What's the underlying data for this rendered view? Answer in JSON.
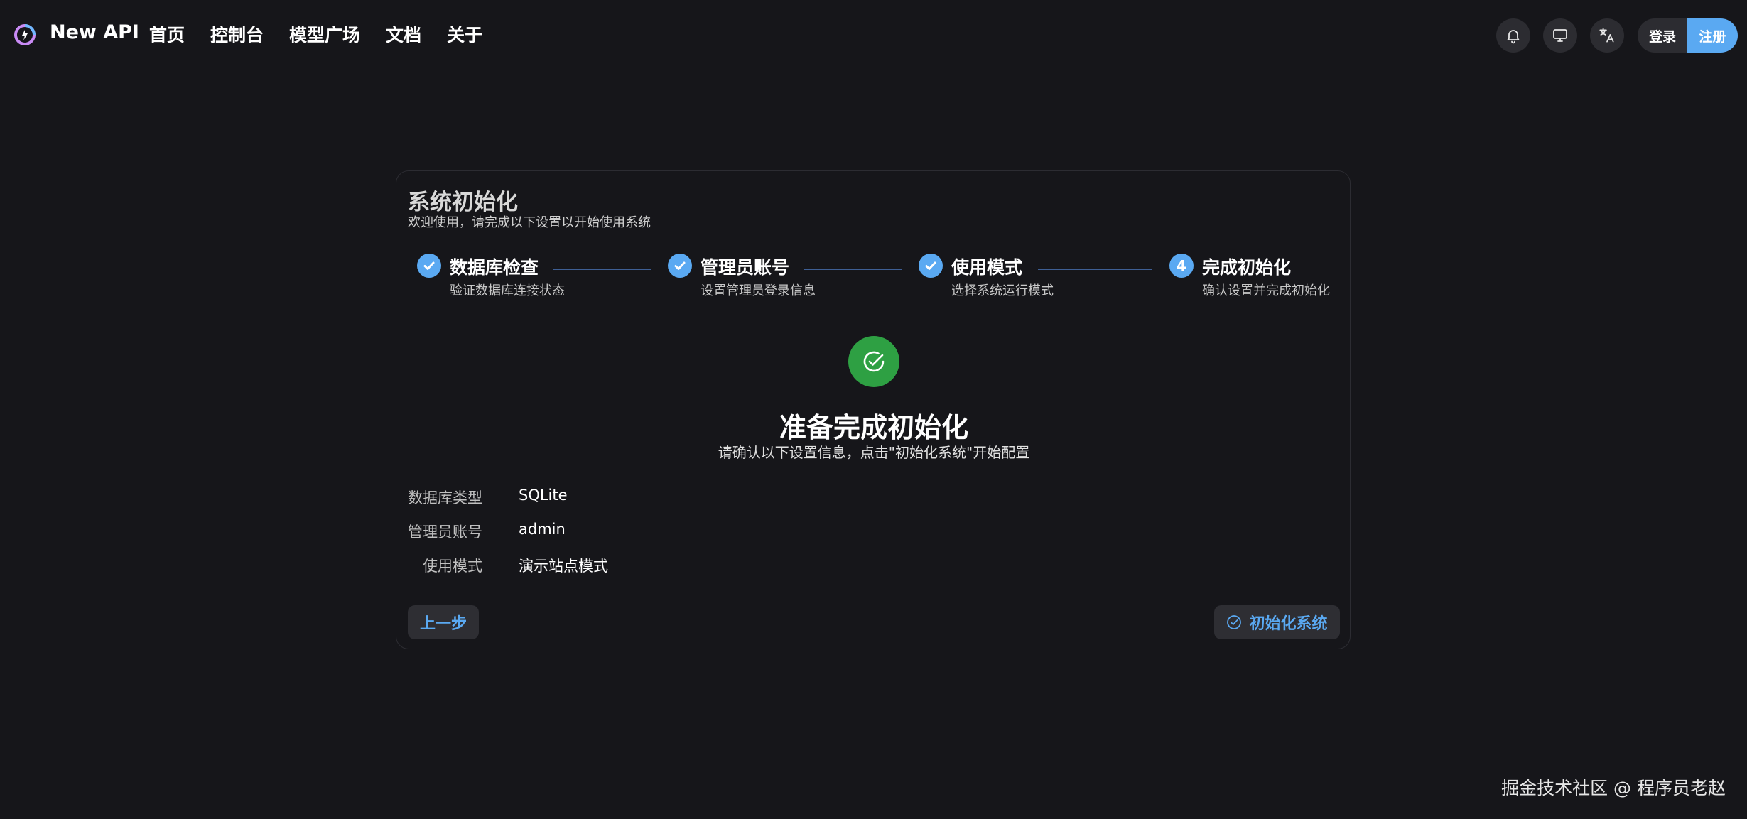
{
  "header": {
    "brand": "New API",
    "nav": [
      "首页",
      "控制台",
      "模型广场",
      "文档",
      "关于"
    ],
    "icons": [
      "bell-icon",
      "monitor-icon",
      "translate-icon"
    ],
    "login_label": "登录",
    "register_label": "注册",
    "accent_color": "#5aa9f2"
  },
  "card": {
    "title": "系统初始化",
    "subtitle": "欢迎使用，请完成以下设置以开始使用系统",
    "steps": [
      {
        "title": "数据库检查",
        "desc": "验证数据库连接状态",
        "status": "done"
      },
      {
        "title": "管理员账号",
        "desc": "设置管理员登录信息",
        "status": "done"
      },
      {
        "title": "使用模式",
        "desc": "选择系统运行模式",
        "status": "done"
      },
      {
        "title": "完成初始化",
        "desc": "确认设置并完成初始化",
        "status": "current",
        "number": "4"
      }
    ],
    "ready_title": "准备完成初始化",
    "ready_subtitle": "请确认以下设置信息，点击\"初始化系统\"开始配置",
    "summary": [
      {
        "label": "数据库类型",
        "value": "SQLite"
      },
      {
        "label": "管理员账号",
        "value": "admin"
      },
      {
        "label": "使用模式",
        "value": "演示站点模式"
      }
    ],
    "prev_label": "上一步",
    "init_label": "初始化系统",
    "success_color": "#2ea043"
  },
  "watermark": "掘金技术社区 @ 程序员老赵"
}
